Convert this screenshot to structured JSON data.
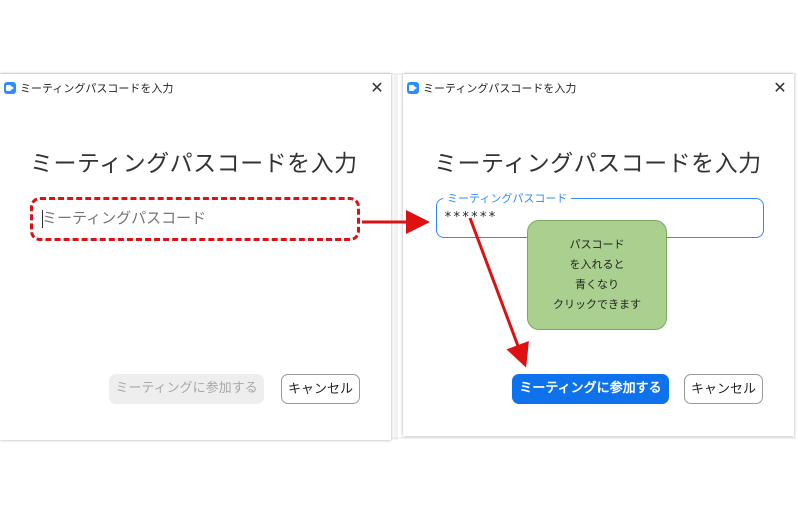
{
  "left_dialog": {
    "window_title": "ミーティングパスコードを入力",
    "heading": "ミーティングパスコードを入力",
    "passcode_placeholder": "ミーティングパスコード",
    "join_button": "ミーティングに参加する",
    "cancel_button": "キャンセル"
  },
  "right_dialog": {
    "window_title": "ミーティングパスコードを入力",
    "heading": "ミーティングパスコードを入力",
    "passcode_label": "ミーティングパスコード",
    "passcode_value": "******",
    "join_button": "ミーティングに参加する",
    "cancel_button": "キャンセル"
  },
  "callout": {
    "lines": [
      "パスコード",
      "を入れると",
      "青くなり",
      "クリックできます"
    ]
  },
  "icons": {
    "app": "zoom-video-icon",
    "close": "close-icon",
    "arrow": "arrow-icon"
  },
  "colors": {
    "accent": "#0e72ed",
    "focus_border": "#2d8cff",
    "annotation_red": "#dd1111",
    "callout_green": "#a9d08e"
  }
}
